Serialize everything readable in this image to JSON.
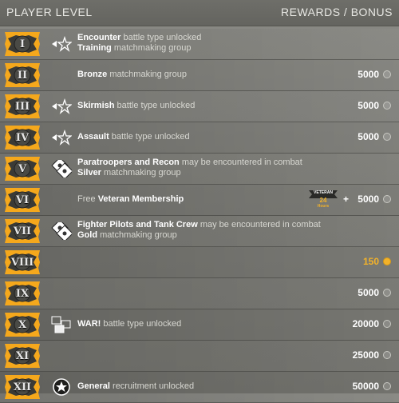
{
  "header": {
    "left": "PLAYER LEVEL",
    "right": "REWARDS / BONUS"
  },
  "rows": [
    {
      "roman": "I",
      "icon": "plane-tank-icon",
      "line1": {
        "bold": "Encounter",
        "dim": " battle type unlocked"
      },
      "line2": {
        "bold": "Training",
        "dim": "  matchmaking group"
      },
      "reward": ""
    },
    {
      "roman": "II",
      "icon": "",
      "line1": {
        "bold": "Bronze",
        "dim": " matchmaking group"
      },
      "line2": null,
      "reward": "5000"
    },
    {
      "roman": "III",
      "icon": "plane-tank-icon",
      "line1": {
        "bold": "Skirmish",
        "dim": " battle type unlocked"
      },
      "line2": null,
      "reward": "5000"
    },
    {
      "roman": "IV",
      "icon": "plane-tank-icon",
      "line1": {
        "bold": "Assault",
        "dim": " battle type unlocked"
      },
      "line2": null,
      "reward": "5000"
    },
    {
      "roman": "V",
      "icon": "paratrooper-icon",
      "line1": {
        "bold": "Paratroopers and Recon",
        "dim": " may be encountered in combat"
      },
      "line2": {
        "bold": "Silver",
        "dim": " matchmaking group"
      },
      "reward": ""
    },
    {
      "roman": "VI",
      "icon": "",
      "line1": {
        "prefix": "Free ",
        "bold": "Veteran Membership",
        "dim": ""
      },
      "line2": null,
      "reward": "5000",
      "veteran": {
        "label": "VETERAN",
        "num": "24",
        "sub": "Hours",
        "plus": "+"
      }
    },
    {
      "roman": "VII",
      "icon": "pilot-tank-icon",
      "line1": {
        "bold": "Fighter Pilots and Tank Crew",
        "dim": " may be encountered in combat"
      },
      "line2": {
        "bold": "Gold",
        "dim": " matchmaking group"
      },
      "reward": ""
    },
    {
      "roman": "VIII",
      "icon": "",
      "line1": null,
      "line2": null,
      "reward": "150",
      "gold": true
    },
    {
      "roman": "IX",
      "icon": "",
      "line1": null,
      "line2": null,
      "reward": "5000"
    },
    {
      "roman": "X",
      "icon": "war-map-icon",
      "line1": {
        "bold": "WAR!",
        "dim": " battle type unlocked"
      },
      "line2": null,
      "reward": "20000"
    },
    {
      "roman": "XI",
      "icon": "",
      "line1": null,
      "line2": null,
      "reward": "25000"
    },
    {
      "roman": "XII",
      "icon": "general-star-icon",
      "line1": {
        "bold": "General",
        "dim": " recruitment unlocked"
      },
      "line2": null,
      "reward": "50000"
    }
  ],
  "colors": {
    "badge_gold": "#f5a81c",
    "badge_dark": "#3a3a36",
    "reward_gold": "#f2b22a"
  }
}
